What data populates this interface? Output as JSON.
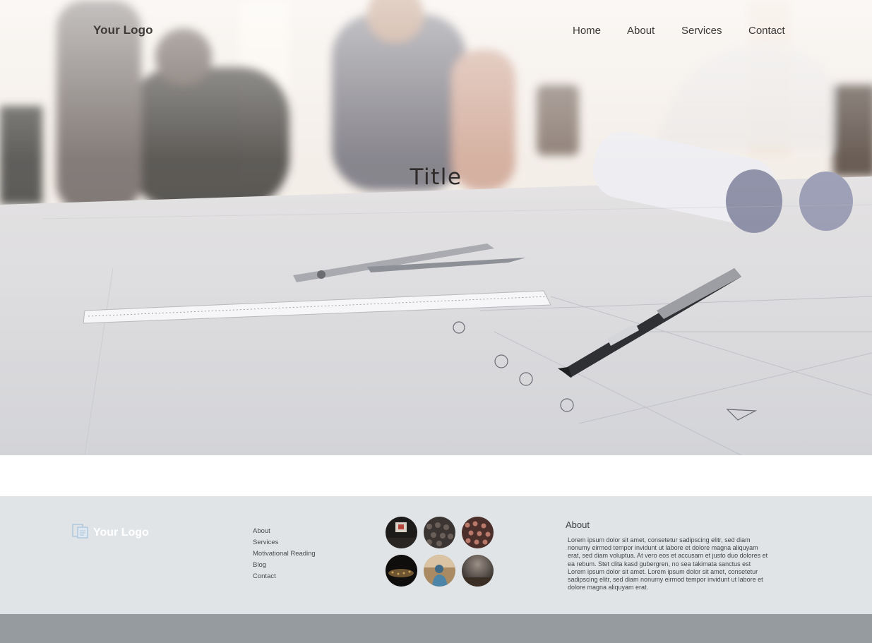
{
  "header": {
    "logo": "Your Logo",
    "nav": [
      {
        "label": "Home"
      },
      {
        "label": "About"
      },
      {
        "label": "Services"
      },
      {
        "label": "Contact"
      }
    ]
  },
  "hero": {
    "title": "Title"
  },
  "footer": {
    "logo": "Your Logo",
    "links": [
      {
        "label": "About"
      },
      {
        "label": "Services"
      },
      {
        "label": "Motivational Reading"
      },
      {
        "label": "Blog"
      },
      {
        "label": "Contact"
      }
    ],
    "about": {
      "heading": "About",
      "text": "Lorem ipsum dolor sit amet, consetetur sadipscing elitr, sed diam nonumy eirmod tempor invidunt ut labore et dolore magna aliquyam erat, sed diam voluptua. At vero eos et accusam et justo duo dolores et ea rebum. Stet clita kasd gubergren, no sea takimata sanctus est Lorem ipsum dolor sit amet. Lorem ipsum dolor sit amet, consetetur sadipscing elitr, sed diam nonumy eirmod tempor invidunt ut labore et dolore magna aliquyam erat."
    },
    "gallery": [
      "presentation-photo",
      "crowd-photo",
      "audience-photo",
      "concert-photo",
      "speaker-photo",
      "hall-photo"
    ]
  },
  "colors": {
    "footer_bg": "#e1e4e7",
    "bottom_bar": "#969ba0",
    "text_dark": "#3e3a37"
  }
}
